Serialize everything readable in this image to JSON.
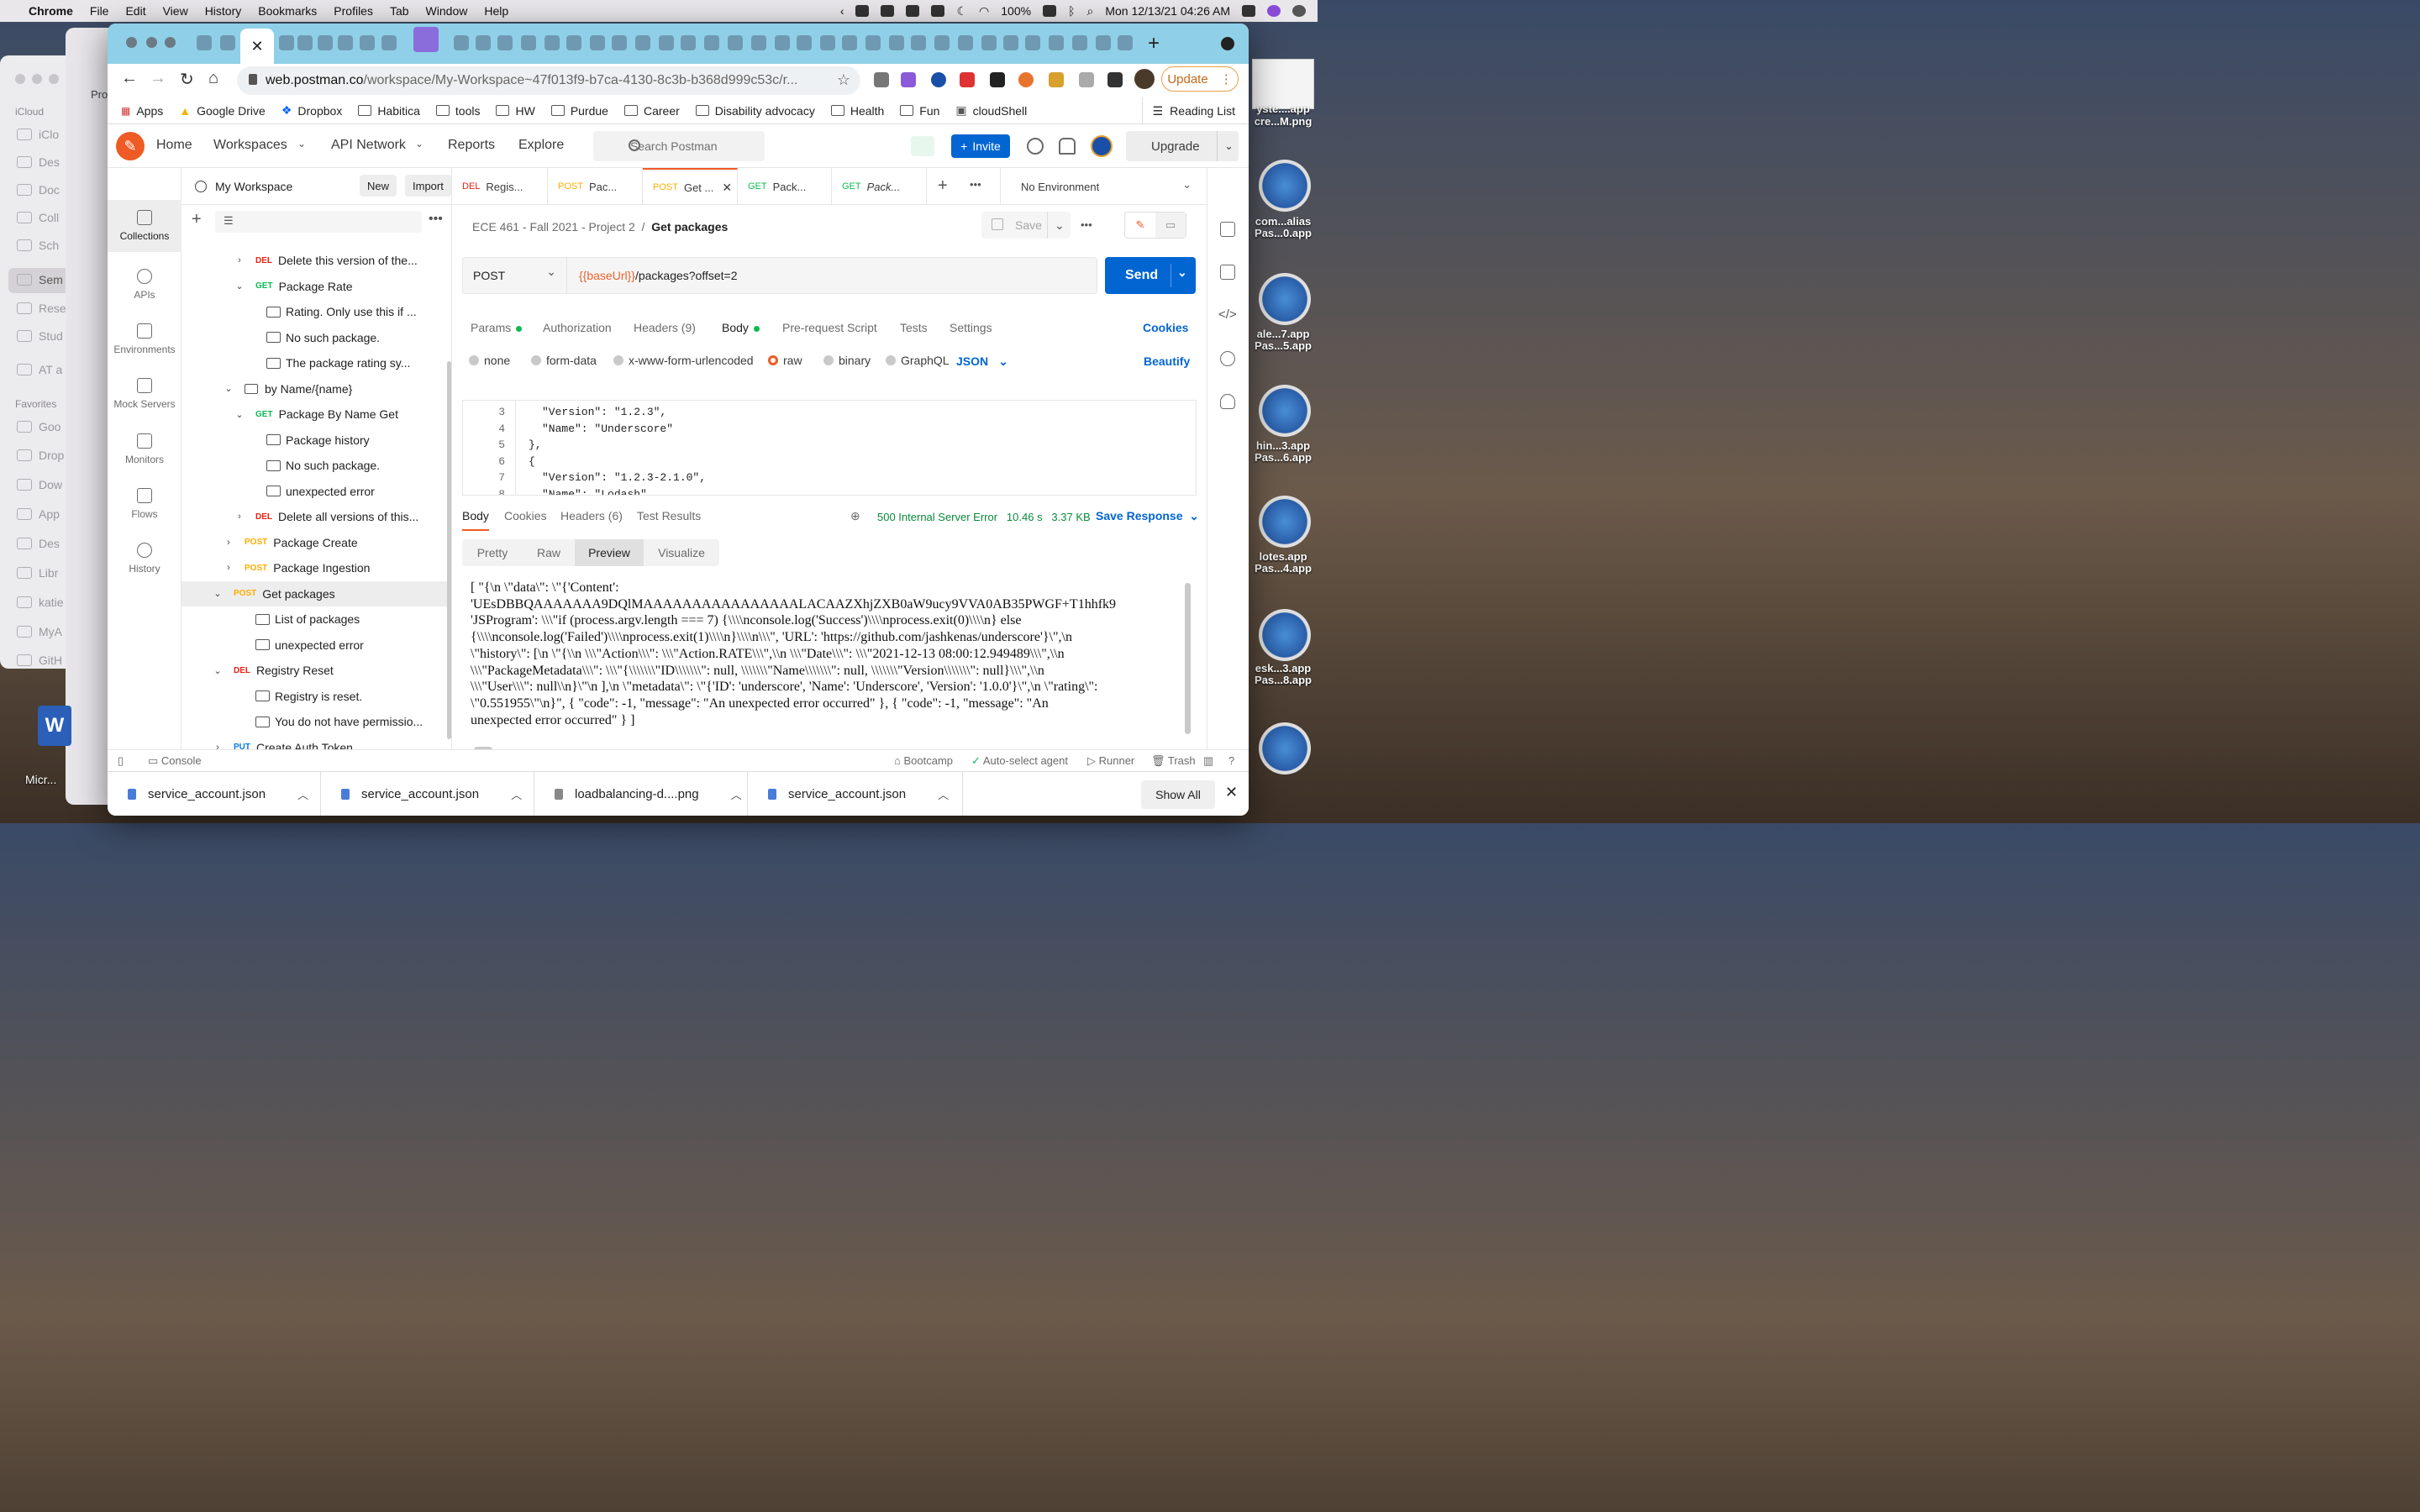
{
  "macos": {
    "app_name": "Chrome",
    "menus": [
      "File",
      "Edit",
      "View",
      "History",
      "Bookmarks",
      "Profiles",
      "Tab",
      "Window",
      "Help"
    ],
    "battery": "100%",
    "datetime": "Mon 12/13/21 04:26 AM"
  },
  "finder": {
    "section_icloud": "iCloud",
    "section_favorites": "Favorites",
    "items": [
      "iClo",
      "Des",
      "Doc",
      "Coll",
      "Sch",
      "Sem",
      "Rese",
      "Stud",
      "AT a"
    ],
    "favorites": [
      "Goo",
      "Drop",
      "Dow",
      "App",
      "Des",
      "Libr",
      "katie",
      "MyA",
      "GitH"
    ],
    "back_window_label": "Pro"
  },
  "desktop": {
    "right_labels": [
      "yste....app",
      "cre...M.png",
      "com...alias",
      "Pas...0.app",
      "ale...7.app",
      "Pas...5.app",
      "hin...3.app",
      "Pas...6.app",
      "lotes.app",
      "Pas...4.app",
      "esk...3.app",
      "Pas...8.app"
    ],
    "word_label": "Micr..."
  },
  "browser": {
    "url_host": "web.postman.co",
    "url_path": "/workspace/My-Workspace~47f013f9-b7ca-4130-8c3b-b368d999c53c/r...",
    "update_label": "Update",
    "bookmarks": [
      "Apps",
      "Google Drive",
      "Dropbox",
      "Habitica",
      "tools",
      "HW",
      "Purdue",
      "Career",
      "Disability advocacy",
      "Health",
      "Fun",
      "cloudShell"
    ],
    "reading_list": "Reading List"
  },
  "postman": {
    "nav": [
      "Home",
      "Workspaces",
      "API Network",
      "Reports",
      "Explore"
    ],
    "search_placeholder": "Search Postman",
    "invite": "Invite",
    "upgrade": "Upgrade",
    "workspace_name": "My Workspace",
    "new_label": "New",
    "import_label": "Import",
    "rail": [
      "Collections",
      "APIs",
      "Environments",
      "Mock Servers",
      "Monitors",
      "Flows",
      "History"
    ],
    "tree": [
      {
        "indent": 1,
        "type": "req",
        "method": "DEL",
        "label": "Delete this version of the..."
      },
      {
        "indent": 1,
        "type": "req-open",
        "method": "GET",
        "label": "Package Rate"
      },
      {
        "indent": 2,
        "type": "ex",
        "label": "Rating. Only use this if ..."
      },
      {
        "indent": 2,
        "type": "ex",
        "label": "No such package."
      },
      {
        "indent": 2,
        "type": "ex",
        "label": "The package rating sy..."
      },
      {
        "indent": 0,
        "type": "folder",
        "label": "by Name/{name}"
      },
      {
        "indent": 1,
        "type": "req-open",
        "method": "GET",
        "label": "Package By Name Get"
      },
      {
        "indent": 2,
        "type": "ex",
        "label": "Package history"
      },
      {
        "indent": 2,
        "type": "ex",
        "label": "No such package."
      },
      {
        "indent": 2,
        "type": "ex",
        "label": "unexpected error"
      },
      {
        "indent": 1,
        "type": "req",
        "method": "DEL",
        "label": "Delete all versions of this..."
      },
      {
        "indent": 0,
        "type": "req",
        "method": "POST",
        "label": "Package Create"
      },
      {
        "indent": 0,
        "type": "req",
        "method": "POST",
        "label": "Package Ingestion"
      },
      {
        "indent": -1,
        "type": "req-open",
        "method": "POST",
        "label": "Get packages",
        "selected": true
      },
      {
        "indent": 1,
        "type": "ex",
        "label": "List of packages"
      },
      {
        "indent": 1,
        "type": "ex",
        "label": "unexpected error"
      },
      {
        "indent": -1,
        "type": "req-open",
        "method": "DEL",
        "label": "Registry Reset"
      },
      {
        "indent": 1,
        "type": "ex",
        "label": "Registry is reset."
      },
      {
        "indent": 1,
        "type": "ex",
        "label": "You do not have permissio..."
      },
      {
        "indent": -1,
        "type": "req",
        "method": "PUT",
        "label": "Create Auth Token"
      }
    ],
    "request_tabs": [
      {
        "method": "DEL",
        "label": "Regis..."
      },
      {
        "method": "POST",
        "label": "Pac..."
      },
      {
        "method": "POST",
        "label": "Get ..."
      },
      {
        "method": "GET",
        "label": "Pack..."
      },
      {
        "method": "GET",
        "label": "Pack..."
      }
    ],
    "environment": "No Environment",
    "breadcrumb_collection": "ECE 461 - Fall 2021 - Project 2",
    "breadcrumb_request": "Get packages",
    "save_label": "Save",
    "method": "POST",
    "url_var": "{{baseUrl}}",
    "url_rest": "/packages?offset=2",
    "send_label": "Send",
    "req_tabs": [
      "Params",
      "Authorization",
      "Headers (9)",
      "Body",
      "Pre-request Script",
      "Tests",
      "Settings"
    ],
    "cookies_label": "Cookies",
    "body_types": [
      "none",
      "form-data",
      "x-www-form-urlencoded",
      "raw",
      "binary",
      "GraphQL"
    ],
    "body_lang": "JSON",
    "beautify_label": "Beautify",
    "code_lines": [
      {
        "n": "3",
        "text": "\"Version\": \"1.2.3\","
      },
      {
        "n": "4",
        "text": "\"Name\": \"Underscore\""
      },
      {
        "n": "5",
        "text": "},"
      },
      {
        "n": "6",
        "text": "{"
      },
      {
        "n": "7",
        "text": "\"Version\": \"1.2.3-2.1.0\","
      },
      {
        "n": "8",
        "text": "\"Name\": \"Lodash\""
      }
    ],
    "resp_tabs": [
      "Body",
      "Cookies",
      "Headers (6)",
      "Test Results"
    ],
    "status": "500 Internal Server Error",
    "time": "10.46 s",
    "size": "3.37 KB",
    "save_response": "Save Response",
    "view_modes": [
      "Pretty",
      "Raw",
      "Preview",
      "Visualize"
    ],
    "preview_lines": [
      "[ \"{\\n \\\"data\\\": \\\"{'Content':",
      "'UEsDBBQAAAAAAA9DQlMAAAAAAAAAAAAAAAALACAAZXhjZXB0aW9ucy9VVA0AB35PWGF+T1hhfk9",
      "'JSProgram': \\\\\\\"if (process.argv.length === 7) {\\\\\\\\nconsole.log('Success')\\\\\\\\nprocess.exit(0)\\\\\\\\n} else",
      "{\\\\\\\\nconsole.log('Failed')\\\\\\\\nprocess.exit(1)\\\\\\\\n}\\\\\\\\n\\\\\\\", 'URL': 'https://github.com/jashkenas/underscore'}\\\",\\n",
      "\\\"history\\\": [\\n \\\"{\\\\n \\\\\\\"Action\\\\\\\": \\\\\\\"Action.RATE\\\\\\\",\\\\n \\\\\\\"Date\\\\\\\": \\\\\\\"2021-12-13 08:00:12.949489\\\\\\\",\\\\n",
      "\\\\\\\"PackageMetadata\\\\\\\": \\\\\\\"{\\\\\\\\\\\\\\\"ID\\\\\\\\\\\\\\\": null, \\\\\\\\\\\\\\\"Name\\\\\\\\\\\\\\\": null, \\\\\\\\\\\\\\\"Version\\\\\\\\\\\\\\\": null}\\\\\\\",\\\\n",
      "\\\\\\\"User\\\\\\\": null\\\\n}\\\"\\n ],\\n \\\"metadata\\\": \\\"{'ID': 'underscore', 'Name': 'Underscore', 'Version': '1.0.0'}\\\",\\n \\\"rating\\\":",
      "\\\"0.551955\\\"\\n}\", { \"code\": -1, \"message\": \"An unexpected error occurred\" }, { \"code\": -1, \"message\": \"An",
      "unexpected error occurred\" } ]"
    ],
    "footer": {
      "console": "Console",
      "bootcamp": "Bootcamp",
      "auto_select": "Auto-select agent",
      "runner": "Runner",
      "trash": "Trash"
    }
  },
  "downloads": {
    "items": [
      "service_account.json",
      "service_account.json",
      "loadbalancing-d....png",
      "service_account.json"
    ],
    "show_all": "Show All"
  }
}
